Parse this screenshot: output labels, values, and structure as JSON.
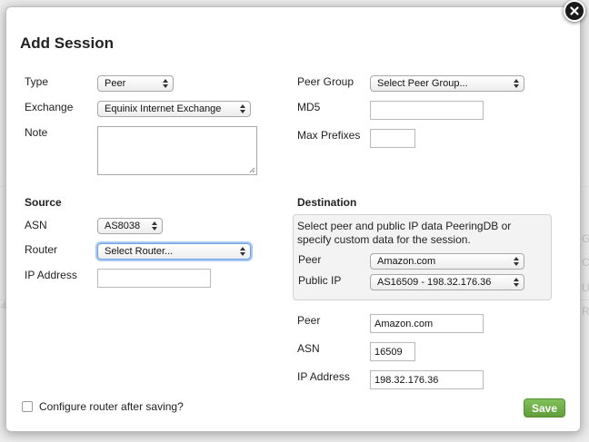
{
  "dialog": {
    "title": "Add Session",
    "close_icon": "close-icon"
  },
  "session": {
    "type_label": "Type",
    "type_value": "Peer",
    "exchange_label": "Exchange",
    "exchange_value": "Equinix Internet Exchange",
    "note_label": "Note",
    "note_value": "",
    "peer_group_label": "Peer Group",
    "peer_group_value": "Select Peer Group...",
    "md5_label": "MD5",
    "md5_value": "",
    "max_prefixes_label": "Max Prefixes",
    "max_prefixes_value": ""
  },
  "source": {
    "heading": "Source",
    "asn_label": "ASN",
    "asn_value": "AS8038",
    "router_label": "Router",
    "router_value": "Select Router...",
    "ip_label": "IP Address",
    "ip_value": ""
  },
  "destination": {
    "heading": "Destination",
    "help_text": "Select peer and public IP data PeeringDB or specify custom data for the session.",
    "lookup_peer_label": "Peer",
    "lookup_peer_value": "Amazon.com",
    "lookup_ip_label": "Public IP",
    "lookup_ip_value": "AS16509 - 198.32.176.36",
    "peer_label": "Peer",
    "peer_value": "Amazon.com",
    "asn_label": "ASN",
    "asn_value": "16509",
    "ip_label": "IP Address",
    "ip_value": "198.32.176.36"
  },
  "footer": {
    "configure_label": "Configure router after saving?",
    "configure_checked": false,
    "save_label": "Save",
    "save_color": "#6aab44"
  }
}
